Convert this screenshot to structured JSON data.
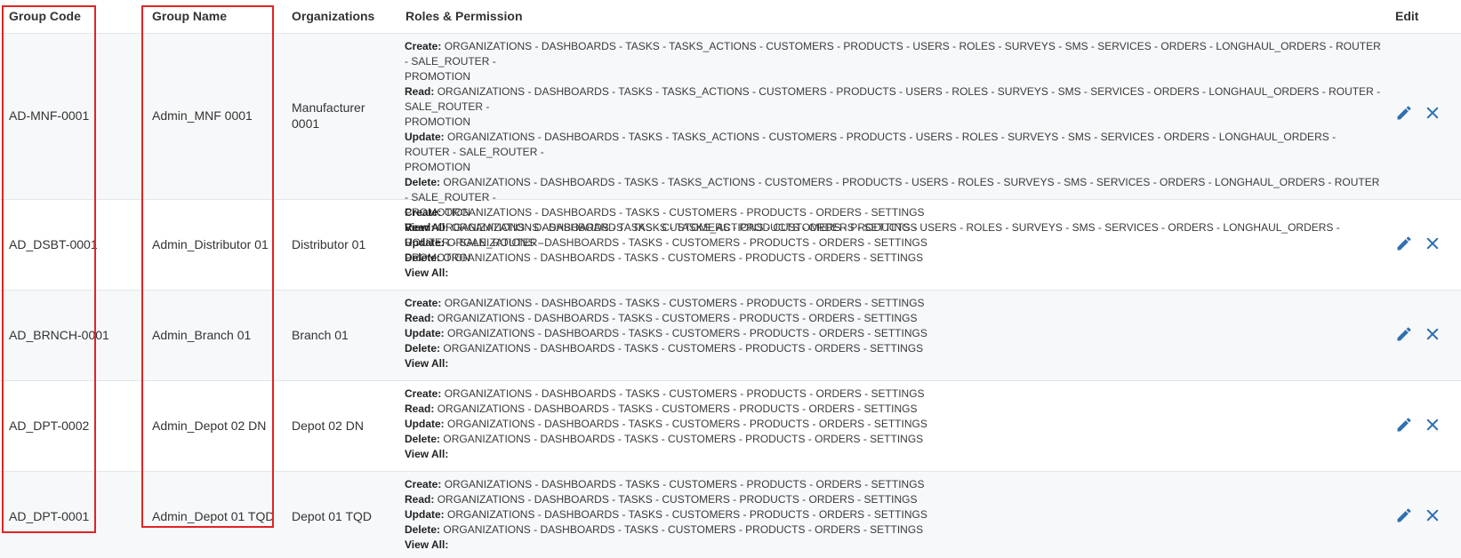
{
  "colors": {
    "accent_icon": "#2f6fb0",
    "highlight": "#e02424"
  },
  "headers": {
    "group_code": "Group Code",
    "group_name": "Group Name",
    "organizations": "Organizations",
    "roles": "Roles & Permission",
    "edit": "Edit"
  },
  "labels": {
    "create": "Create:",
    "read": "Read:",
    "update": "Update:",
    "delete": "Delete:",
    "view_all": "View All:"
  },
  "rows": [
    {
      "group_code": "AD-MNF-0001",
      "group_name": "Admin_MNF 0001",
      "org_line1": "Manufacturer",
      "org_line2": "0001",
      "create": "ORGANIZATIONS - DASHBOARDS - TASKS - TASKS_ACTIONS - CUSTOMERS - PRODUCTS - USERS - ROLES - SURVEYS - SMS - SERVICES - ORDERS - LONGHAUL_ORDERS - ROUTER - SALE_ROUTER -",
      "create2": "PROMOTION",
      "read": "ORGANIZATIONS - DASHBOARDS - TASKS - TASKS_ACTIONS - CUSTOMERS - PRODUCTS - USERS - ROLES - SURVEYS - SMS - SERVICES - ORDERS - LONGHAUL_ORDERS - ROUTER - SALE_ROUTER -",
      "read2": "PROMOTION",
      "update": "ORGANIZATIONS - DASHBOARDS - TASKS - TASKS_ACTIONS - CUSTOMERS - PRODUCTS - USERS - ROLES - SURVEYS - SMS - SERVICES - ORDERS - LONGHAUL_ORDERS - ROUTER - SALE_ROUTER -",
      "update2": "PROMOTION",
      "delete": "ORGANIZATIONS - DASHBOARDS - TASKS - TASKS_ACTIONS - CUSTOMERS - PRODUCTS - USERS - ROLES - SURVEYS - SMS - SERVICES - ORDERS - LONGHAUL_ORDERS - ROUTER - SALE_ROUTER -",
      "delete2": "PROMOTION",
      "view_all": "ORGANIZATIONS - DASHBOARDS - TASKS - TASKS_ACTIONS - CUSTOMERS - PRODUCTS - USERS - ROLES - SURVEYS - SMS - SERVICES - ORDERS - LONGHAUL_ORDERS - ROUTER - SALE_ROUTER -",
      "view_all2": "PROMOTION"
    },
    {
      "group_code": "AD_DSBT-0001",
      "group_name": "Admin_Distributor 01",
      "organization": "Distributor 01",
      "create": "ORGANIZATIONS - DASHBOARDS - TASKS - CUSTOMERS - PRODUCTS - ORDERS - SETTINGS",
      "read": "ORGANIZATIONS - DASHBOARDS - TASKS - CUSTOMERS - PRODUCTS - ORDERS - SETTINGS",
      "update": "ORGANIZATIONS - DASHBOARDS - TASKS - CUSTOMERS - PRODUCTS - ORDERS - SETTINGS",
      "delete": "ORGANIZATIONS - DASHBOARDS - TASKS - CUSTOMERS - PRODUCTS - ORDERS - SETTINGS",
      "view_all": ""
    },
    {
      "group_code": "AD_BRNCH-0001",
      "group_name": "Admin_Branch 01",
      "organization": "Branch 01",
      "create": "ORGANIZATIONS - DASHBOARDS - TASKS - CUSTOMERS - PRODUCTS - ORDERS - SETTINGS",
      "read": "ORGANIZATIONS - DASHBOARDS - TASKS - CUSTOMERS - PRODUCTS - ORDERS - SETTINGS",
      "update": "ORGANIZATIONS - DASHBOARDS - TASKS - CUSTOMERS - PRODUCTS - ORDERS - SETTINGS",
      "delete": "ORGANIZATIONS - DASHBOARDS - TASKS - CUSTOMERS - PRODUCTS - ORDERS - SETTINGS",
      "view_all": ""
    },
    {
      "group_code": "AD_DPT-0002",
      "group_name": "Admin_Depot 02 DN",
      "organization": "Depot 02 DN",
      "create": "ORGANIZATIONS - DASHBOARDS - TASKS - CUSTOMERS - PRODUCTS - ORDERS - SETTINGS",
      "read": "ORGANIZATIONS - DASHBOARDS - TASKS - CUSTOMERS - PRODUCTS - ORDERS - SETTINGS",
      "update": "ORGANIZATIONS - DASHBOARDS - TASKS - CUSTOMERS - PRODUCTS - ORDERS - SETTINGS",
      "delete": "ORGANIZATIONS - DASHBOARDS - TASKS - CUSTOMERS - PRODUCTS - ORDERS - SETTINGS",
      "view_all": ""
    },
    {
      "group_code": "AD_DPT-0001",
      "group_name": "Admin_Depot 01 TQD",
      "organization": "Depot 01 TQD",
      "create": "ORGANIZATIONS - DASHBOARDS - TASKS - CUSTOMERS - PRODUCTS - ORDERS - SETTINGS",
      "read": "ORGANIZATIONS - DASHBOARDS - TASKS - CUSTOMERS - PRODUCTS - ORDERS - SETTINGS",
      "update": "ORGANIZATIONS - DASHBOARDS - TASKS - CUSTOMERS - PRODUCTS - ORDERS - SETTINGS",
      "delete": "ORGANIZATIONS - DASHBOARDS - TASKS - CUSTOMERS - PRODUCTS - ORDERS - SETTINGS",
      "view_all": ""
    }
  ]
}
